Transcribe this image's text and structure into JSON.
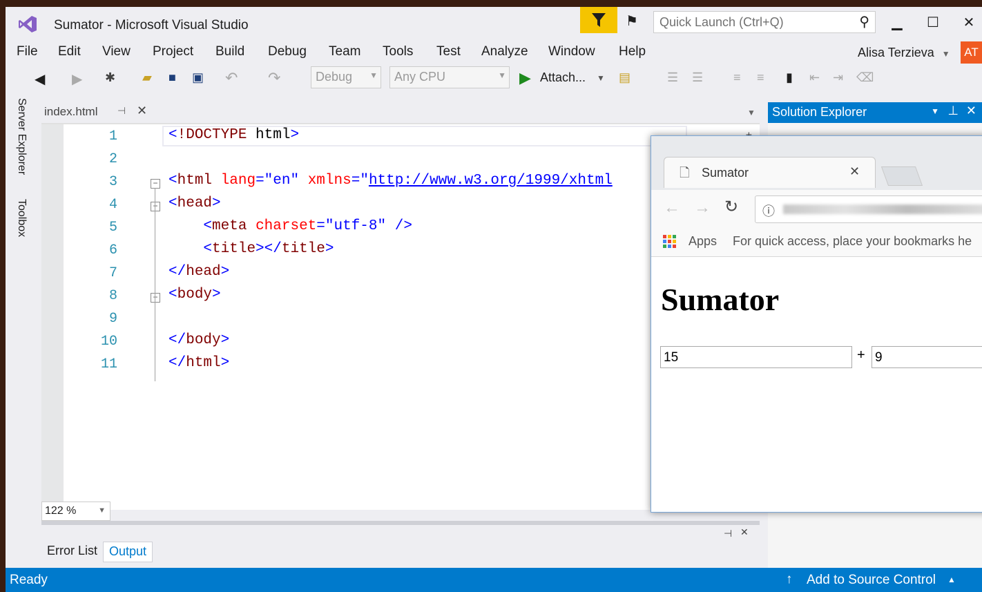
{
  "window": {
    "title": "Sumator - Microsoft Visual Studio"
  },
  "quick_launch": {
    "placeholder": "Quick Launch (Ctrl+Q)"
  },
  "menu": [
    "File",
    "Edit",
    "View",
    "Project",
    "Build",
    "Debug",
    "Team",
    "Tools",
    "Test",
    "Analyze",
    "Window",
    "Help"
  ],
  "account": {
    "name": "Alisa Terzieva",
    "initials": "AT"
  },
  "toolbar": {
    "config": "Debug",
    "platform": "Any CPU",
    "attach_label": "Attach..."
  },
  "side_tabs": [
    "Server Explorer",
    "Toolbox"
  ],
  "document_tab": {
    "name": "index.html"
  },
  "code_lines": [
    "<!DOCTYPE html>",
    "",
    "<html lang=\"en\" xmlns=\"http://www.w3.org/1999/xhtml",
    "<head>",
    "    <meta charset=\"utf-8\" />",
    "    <title></title>",
    "</head>",
    "<body>",
    "",
    "</body>",
    "</html>"
  ],
  "zoom": "122 %",
  "bottom_tabs": [
    "Error List",
    "Output"
  ],
  "solution_explorer": {
    "title": "Solution Explorer"
  },
  "status": {
    "left": "Ready",
    "right": "Add to Source Control"
  },
  "browser": {
    "tab_title": "Sumator",
    "bookmarks_apps": "Apps",
    "bookmarks_hint": "For quick access, place your bookmarks he",
    "page_heading": "Sumator",
    "input_a": "15",
    "operator": "+",
    "input_b": "9"
  },
  "colors": {
    "vs_accent": "#007acc",
    "filter_yellow": "#f5c400",
    "avatar": "#f05a22"
  }
}
